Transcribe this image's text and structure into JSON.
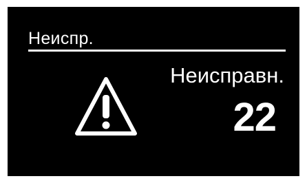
{
  "menu": {
    "title": "Неиспр."
  },
  "fault": {
    "label": "Неисправн.",
    "count": "22",
    "icon": "warning-triangle-icon"
  }
}
